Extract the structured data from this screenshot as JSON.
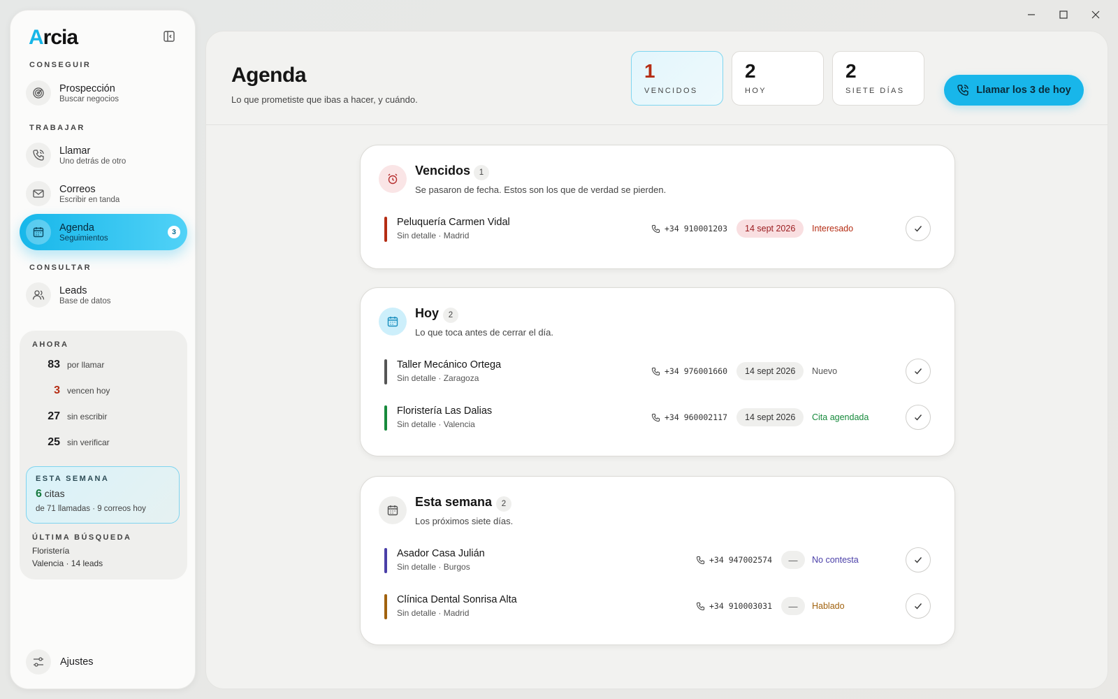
{
  "window": {
    "minimize_icon": "minimize-icon",
    "maximize_icon": "maximize-icon",
    "close_icon": "close-icon"
  },
  "brand": {
    "logo_first": "A",
    "logo_rest": "rcia",
    "accent": "#16b6e8"
  },
  "sidebar": {
    "sections": {
      "get": "CONSEGUIR",
      "work": "TRABAJAR",
      "consult": "CONSULTAR"
    },
    "items": [
      {
        "title": "Prospección",
        "sub": "Buscar negocios",
        "icon": "radar-icon"
      },
      {
        "title": "Llamar",
        "sub": "Uno detrás de otro",
        "icon": "phone-icon"
      },
      {
        "title": "Correos",
        "sub": "Escribir en tanda",
        "icon": "mail-icon"
      },
      {
        "title": "Agenda",
        "sub": "Seguimientos",
        "icon": "calendar-icon",
        "badge": "3",
        "active": true
      },
      {
        "title": "Leads",
        "sub": "Base de datos",
        "icon": "users-icon"
      }
    ],
    "now": {
      "label": "AHORA",
      "stats": [
        {
          "num": "83",
          "text": "por llamar"
        },
        {
          "num": "3",
          "text": "vencen hoy"
        },
        {
          "num": "27",
          "text": "sin escribir"
        },
        {
          "num": "25",
          "text": "sin verificar"
        }
      ]
    },
    "week": {
      "label": "ESTA SEMANA",
      "count": "6",
      "unit": "citas",
      "sub": "de 71 llamadas · 9 correos hoy"
    },
    "last_search": {
      "label": "ÚLTIMA BÚSQUEDA",
      "term": "Floristería",
      "detail": "Valencia · 14 leads"
    },
    "settings": "Ajustes"
  },
  "header": {
    "title": "Agenda",
    "subtitle": "Lo que prometiste que ibas a hacer, y cuándo.",
    "kpis": [
      {
        "num": "1",
        "label": "VENCIDOS"
      },
      {
        "num": "2",
        "label": "HOY"
      },
      {
        "num": "2",
        "label": "SIETE DÍAS"
      }
    ],
    "cta": "Llamar los 3 de hoy"
  },
  "groups": {
    "overdue": {
      "title": "Vencidos",
      "count": "1",
      "subtitle": "Se pasaron de fecha. Estos son los que de verdad se pierden.",
      "leads": [
        {
          "name": "Peluquería Carmen Vidal",
          "meta": "Sin detalle · Madrid",
          "phone": "+34 910001203",
          "date": "14 sept 2026",
          "status": "Interesado",
          "bar": "#b52d14",
          "status_color": "#b52d14"
        }
      ]
    },
    "today": {
      "title": "Hoy",
      "count": "2",
      "subtitle": "Lo que toca antes de cerrar el día.",
      "leads": [
        {
          "name": "Taller Mecánico Ortega",
          "meta": "Sin detalle · Zaragoza",
          "phone": "+34 976001660",
          "date": "14 sept 2026",
          "status": "Nuevo",
          "bar": "#555555",
          "status_color": "#555555"
        },
        {
          "name": "Floristería Las Dalias",
          "meta": "Sin detalle · Valencia",
          "phone": "+34 960002117",
          "date": "14 sept 2026",
          "status": "Cita agendada",
          "bar": "#178a3c",
          "status_color": "#178a3c"
        }
      ]
    },
    "week": {
      "title": "Esta semana",
      "count": "2",
      "subtitle": "Los próximos siete días.",
      "leads": [
        {
          "name": "Asador Casa Julián",
          "meta": "Sin detalle · Burgos",
          "phone": "+34 947002574",
          "date": "—",
          "status": "No contesta",
          "bar": "#4a3fa8",
          "status_color": "#4a3fa8"
        },
        {
          "name": "Clínica Dental Sonrisa Alta",
          "meta": "Sin detalle · Madrid",
          "phone": "+34 910003031",
          "date": "—",
          "status": "Hablado",
          "bar": "#a1620e",
          "status_color": "#a1620e"
        }
      ]
    }
  }
}
